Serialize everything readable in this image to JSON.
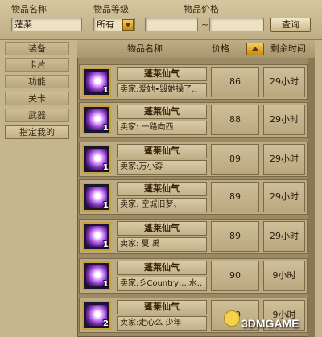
{
  "search": {
    "name_label": "物品名称",
    "name_value": "蓬莱",
    "level_label": "物品等级",
    "level_value": "所有",
    "price_label": "物品价格",
    "price_min": "",
    "price_max": "",
    "price_sep": "~",
    "query_label": "查询"
  },
  "sidebar": {
    "items": [
      {
        "label": "装备"
      },
      {
        "label": "卡片"
      },
      {
        "label": "功能"
      },
      {
        "label": "关卡"
      },
      {
        "label": "武器"
      },
      {
        "label": "指定我的"
      }
    ]
  },
  "table": {
    "headers": {
      "name": "物品名称",
      "price": "价格",
      "time": "剩余时间"
    },
    "rows": [
      {
        "count": "1",
        "name": "蓬莱仙气",
        "seller": "卖家:爱她•毁她操了..",
        "price": "86",
        "time": "29小时"
      },
      {
        "count": "1",
        "name": "蓬莱仙气",
        "seller": "卖家:      一路向西",
        "price": "88",
        "time": "29小时"
      },
      {
        "count": "1",
        "name": "蓬莱仙气",
        "seller": "卖家:万小孬",
        "price": "89",
        "time": "29小时"
      },
      {
        "count": "1",
        "name": "蓬莱仙气",
        "seller": "卖家:      空城旧梦、",
        "price": "89",
        "time": "29小时"
      },
      {
        "count": "1",
        "name": "蓬莱仙气",
        "seller": "卖家:    夏  禹",
        "price": "89",
        "time": "29小时"
      },
      {
        "count": "1",
        "name": "蓬莱仙气",
        "seller": "卖家:彡Country,,,,水..",
        "price": "90",
        "time": "9小时"
      },
      {
        "count": "2",
        "name": "蓬莱仙气",
        "seller": "卖家:走心么    少年",
        "price": "90",
        "time": "9小时"
      }
    ]
  },
  "watermark": "3DMGAME"
}
